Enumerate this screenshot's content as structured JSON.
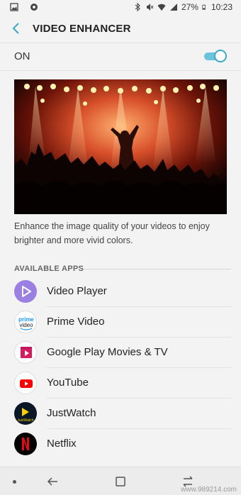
{
  "status_bar": {
    "battery": "27%",
    "time": "10:23"
  },
  "header": {
    "title": "VIDEO ENHANCER"
  },
  "toggle": {
    "label": "ON",
    "state": "on"
  },
  "description": "Enhance the image quality of your videos to enjoy brighter and more vivid colors.",
  "section_title": "AVAILABLE APPS",
  "apps": [
    {
      "name": "Video Player",
      "icon": "video-player-icon",
      "color": "#9b7fe3"
    },
    {
      "name": "Prime Video",
      "icon": "prime-video-icon",
      "color": "#1a98ff",
      "badge": "prime video"
    },
    {
      "name": "Google Play Movies & TV",
      "icon": "play-movies-icon",
      "color": "#d81b60"
    },
    {
      "name": "YouTube",
      "icon": "youtube-icon",
      "color": "#ff0000"
    },
    {
      "name": "JustWatch",
      "icon": "justwatch-icon",
      "color": "#f8d200",
      "badge": "JustWatch"
    },
    {
      "name": "Netflix",
      "icon": "netflix-icon",
      "color": "#e50914"
    }
  ],
  "watermark": "www.989214.com",
  "colors": {
    "accent": "#3aa9c8",
    "background": "#f3f3f3"
  }
}
